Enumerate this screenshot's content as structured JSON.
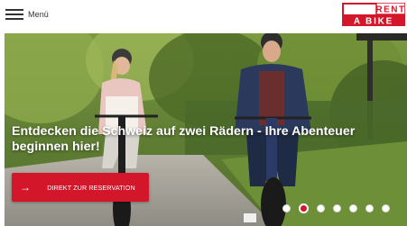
{
  "header": {
    "menu_label": "Menü",
    "logo": {
      "line1": "RENT",
      "line2": "A BIKE",
      "brand_color": "#d4162b"
    }
  },
  "hero": {
    "headline": "Entdecken die Schweiz auf zwei Rädern - Ihre Abenteuer beginnen hier!",
    "cta_label": "DIREKT ZUR RESERVATION",
    "cta_icon": "arrow-right-icon",
    "slides": [
      {
        "active": false
      },
      {
        "active": true
      },
      {
        "active": false
      },
      {
        "active": false
      },
      {
        "active": false
      },
      {
        "active": false
      },
      {
        "active": false
      }
    ]
  },
  "colors": {
    "accent": "#d4162b",
    "text_dark": "#333333"
  }
}
